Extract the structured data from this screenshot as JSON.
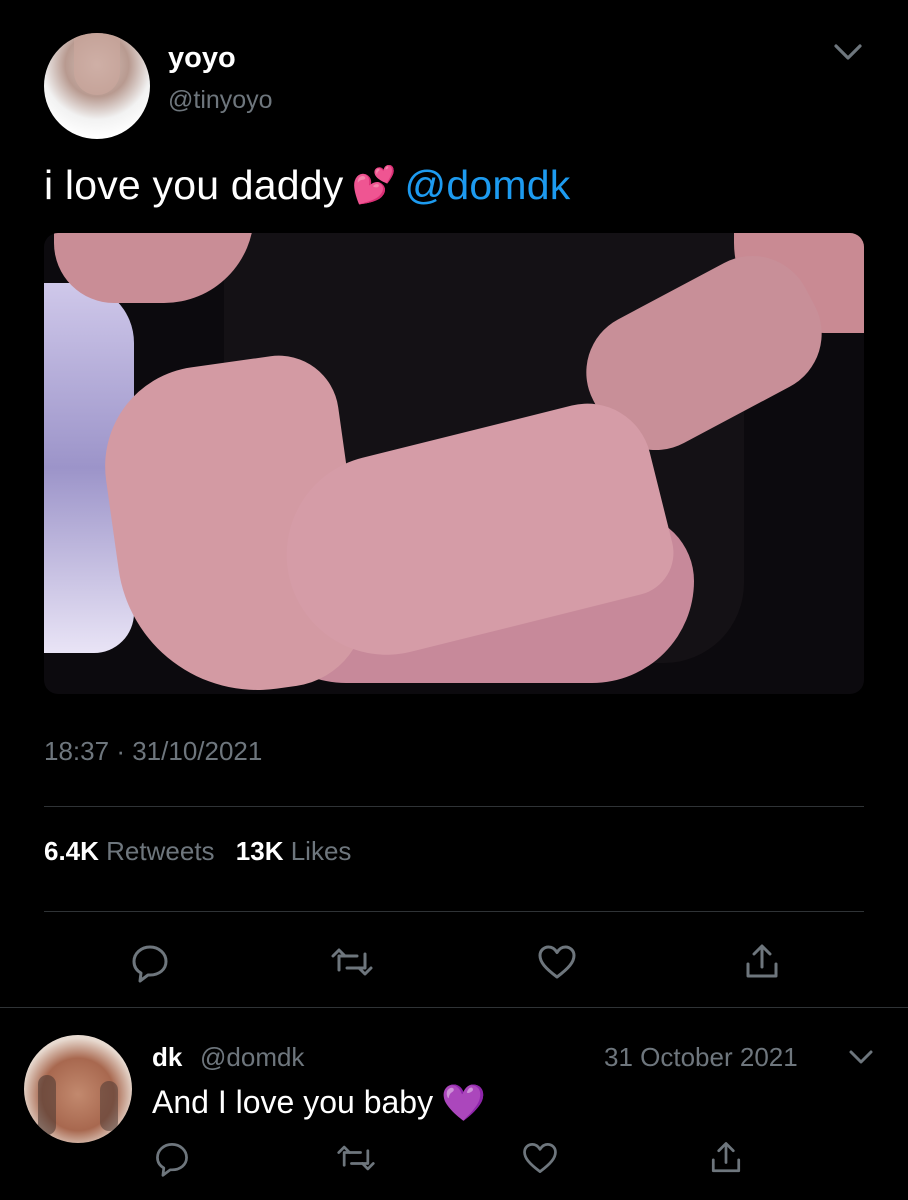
{
  "tweet": {
    "display_name": "yoyo",
    "handle": "@tinyoyo",
    "text": "i love you daddy",
    "emoji": "💕",
    "mention": "@domdk",
    "time": "18:37",
    "separator": "·",
    "date": "31/10/2021",
    "retweets_count": "6.4K",
    "retweets_label": "Retweets",
    "likes_count": "13K",
    "likes_label": "Likes"
  },
  "reply": {
    "display_name": "dk",
    "handle": "@domdk",
    "date": "31 October 2021",
    "text": "And I love you baby",
    "emoji": "💜"
  },
  "icons": {
    "reply": "reply-icon",
    "retweet": "retweet-icon",
    "like": "heart-icon",
    "share": "share-icon",
    "menu": "chevron-down-icon"
  },
  "colors": {
    "background": "#000000",
    "text_primary": "#ffffff",
    "text_secondary": "#6e767d",
    "link": "#1d9bf0",
    "divider": "#2f3336"
  }
}
